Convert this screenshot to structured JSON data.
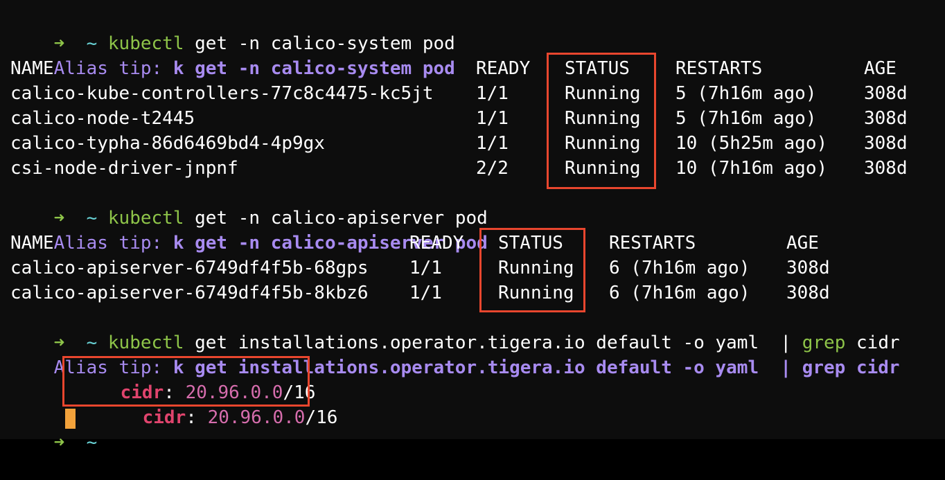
{
  "terminal": {
    "prompt_arrow": "➜",
    "prompt_dir": "~",
    "commands": [
      {
        "cmd": "kubectl",
        "args": " get -n calico-system pod",
        "alias_label": "Alias tip: ",
        "alias_cmd": "k get -n calico-system pod"
      },
      {
        "cmd": "kubectl",
        "args": " get -n calico-apiserver pod",
        "alias_label": "Alias tip: ",
        "alias_cmd": "k get -n calico-apiserver pod"
      },
      {
        "cmd": "kubectl",
        "args": " get installations.operator.tigera.io default -o yaml  | ",
        "grep": "grep",
        "grep_args": " cidr",
        "alias_label": "Alias tip: ",
        "alias_cmd": "k get installations.operator.tigera.io default -o yaml  | grep cidr"
      }
    ],
    "table1": {
      "headers": [
        "NAME",
        "READY",
        "STATUS",
        "RESTARTS",
        "AGE"
      ],
      "rows": [
        [
          "calico-kube-controllers-77c8c4475-kc5jt",
          "1/1",
          "Running",
          "5 (7h16m ago)",
          "308d"
        ],
        [
          "calico-node-t2445",
          "1/1",
          "Running",
          "5 (7h16m ago)",
          "308d"
        ],
        [
          "calico-typha-86d6469bd4-4p9gx",
          "1/1",
          "Running",
          "10 (5h25m ago)",
          "308d"
        ],
        [
          "csi-node-driver-jnpnf",
          "2/2",
          "Running",
          "10 (7h16m ago)",
          "308d"
        ]
      ]
    },
    "table2": {
      "headers": [
        "NAME",
        "READY",
        "STATUS",
        "RESTARTS",
        "AGE"
      ],
      "rows": [
        [
          "calico-apiserver-6749df4f5b-68gps",
          "1/1",
          "Running",
          "6 (7h16m ago)",
          "308d"
        ],
        [
          "calico-apiserver-6749df4f5b-8kbz6",
          "1/1",
          "Running",
          "6 (7h16m ago)",
          "308d"
        ]
      ]
    },
    "yaml_output": [
      {
        "key": "cidr",
        "sep": ": ",
        "value": "20.96.0.0",
        "suffix": "/16"
      },
      {
        "key": "cidr",
        "sep": ": ",
        "value": "20.96.0.0",
        "suffix": "/16"
      }
    ]
  },
  "colors": {
    "background": "#0d0d0d",
    "prompt_arrow": "#8ec449",
    "prompt_dir": "#69d3d6",
    "alias_tip": "#a88bf0",
    "yaml_key": "#e0446d",
    "yaml_value": "#d66dad",
    "highlight_box": "#e8462e",
    "cursor": "#f2a23b"
  }
}
